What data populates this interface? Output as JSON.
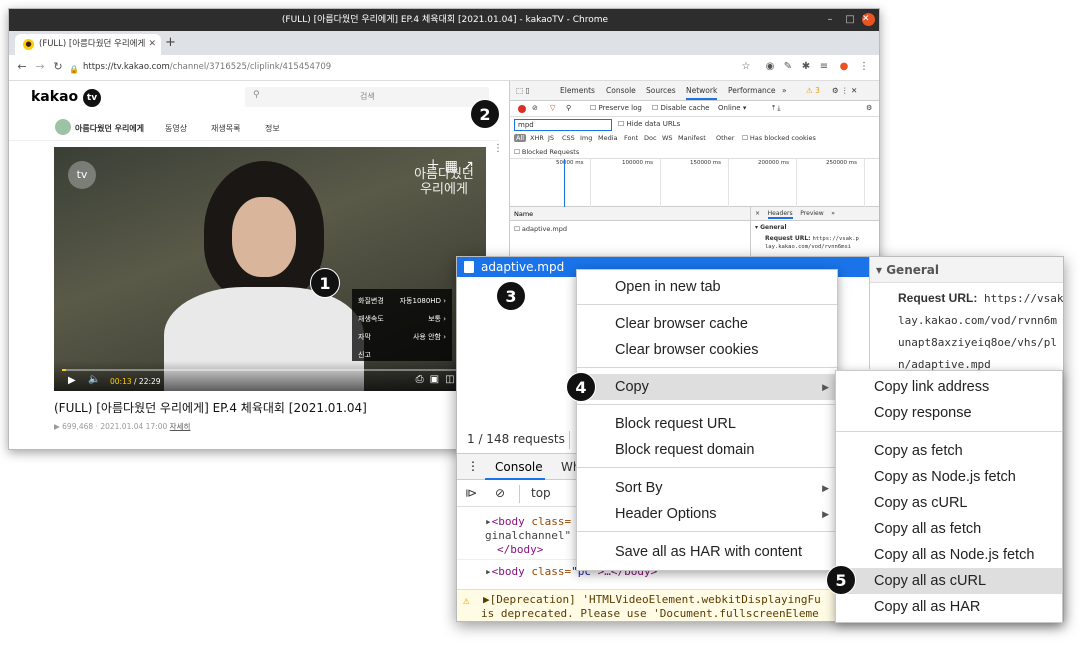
{
  "window": {
    "title": "(FULL) [아름다웠던 우리에게] EP.4 체육대회 [2021.01.04] - kakaoTV - Chrome",
    "tab_label": "(FULL) [아름다웠던 우리에게",
    "url_host": "https://tv.kakao.com",
    "url_path": "/channel/3716525/cliplink/415454709"
  },
  "site": {
    "logo": "kakao",
    "logo_tv": "tv",
    "search_placeholder": "검색",
    "channel_name": "아름다웠던 우리에게",
    "nav": [
      "동영상",
      "재생목록",
      "정보"
    ],
    "video_badge": "tv",
    "video_art_title": "아름다웠던 우리에게",
    "settings": [
      {
        "label": "화질변경",
        "value": "자동1080HD"
      },
      {
        "label": "재생속도",
        "value": "보통"
      },
      {
        "label": "자막",
        "value": "사용 안함"
      },
      {
        "label": "신고",
        "value": ""
      }
    ],
    "time_current": "00:13",
    "time_total": "/ 22:29",
    "progress": 0.01,
    "caption": "(FULL) [아름다웠던 우리에게] EP.4 체육대회 [2021.01.04]",
    "views": "▶ 699,468",
    "date": "2021.01.04 17:00",
    "details": "자세히"
  },
  "devtools": {
    "tabs": [
      "Elements",
      "Console",
      "Sources",
      "Network",
      "Performance",
      "»"
    ],
    "warn_count": "⚠ 3",
    "preserve_log": "Preserve log",
    "disable_cache": "Disable cache",
    "throttle": "Online",
    "filter_value": "mpd",
    "hide_data_urls": "Hide data URLs",
    "types": [
      "All",
      "XHR",
      "JS",
      "CSS",
      "Img",
      "Media",
      "Font",
      "Doc",
      "WS",
      "Manifest",
      "Other"
    ],
    "has_blocked": "Has blocked cookies",
    "blocked_requests": "Blocked Requests",
    "timeline_ticks": [
      "50000 ms",
      "100000 ms",
      "150000 ms",
      "200000 ms",
      "250000 ms"
    ],
    "name_header": "Name",
    "request_name": "adaptive.mpd",
    "right_tabs": [
      "×",
      "Headers",
      "Preview",
      "»"
    ],
    "general_small": "▾ General",
    "req_url_label_small": "Request URL:",
    "req_url_small_1": "https://vsak.p",
    "req_url_small_2": "lay.kakao.com/vod/rvnn6msi"
  },
  "zoom": {
    "request_name": "adaptive.mpd",
    "request_count": "1 / 148 requests",
    "console_tab": "Console",
    "whats_new": "Wh",
    "context": "top",
    "console_lines": {
      "body1_tag": "<body",
      "body1_attr": " class=",
      "body1_cont": "ginalchannel\"",
      "body1_close": "</body>",
      "body2_tag": "<body",
      "body2_attr": " class=",
      "body2_val": "\"pc\"",
      "body2_rest": ">…</body>",
      "warn_1": "▶[Deprecation] 'HTMLVideoElement.webkitDisplayingFu",
      "warn_2": "is deprecated. Please use 'Document.fullscreenEleme"
    },
    "general_header": "▾ General",
    "request_url_label": "Request URL:",
    "request_url_lines": [
      "https://vsak",
      "lay.kakao.com/vod/rvnn6m",
      "unapt8axziyeiq8oe/vhs/pl",
      "n/adaptive.mpd"
    ]
  },
  "menu_main": [
    {
      "label": "Open in new tab",
      "sub": false
    },
    {
      "label": "Clear browser cache",
      "sub": false
    },
    {
      "label": "Clear browser cookies",
      "sub": false
    },
    {
      "label": "Copy",
      "sub": true
    },
    {
      "label": "Block request URL",
      "sub": false
    },
    {
      "label": "Block request domain",
      "sub": false
    },
    {
      "label": "Sort By",
      "sub": true
    },
    {
      "label": "Header Options",
      "sub": true
    },
    {
      "label": "Save all as HAR with content",
      "sub": false
    }
  ],
  "menu_copy": [
    "Copy link address",
    "Copy response",
    "Copy as fetch",
    "Copy as Node.js fetch",
    "Copy as cURL",
    "Copy all as fetch",
    "Copy all as Node.js fetch",
    "Copy all as cURL",
    "Copy all as HAR"
  ],
  "badges": [
    "1",
    "2",
    "3",
    "4",
    "5"
  ],
  "icons": {
    "arrow_right": "▶",
    "close": "✕",
    "minimize": "–",
    "maximize": "□"
  }
}
